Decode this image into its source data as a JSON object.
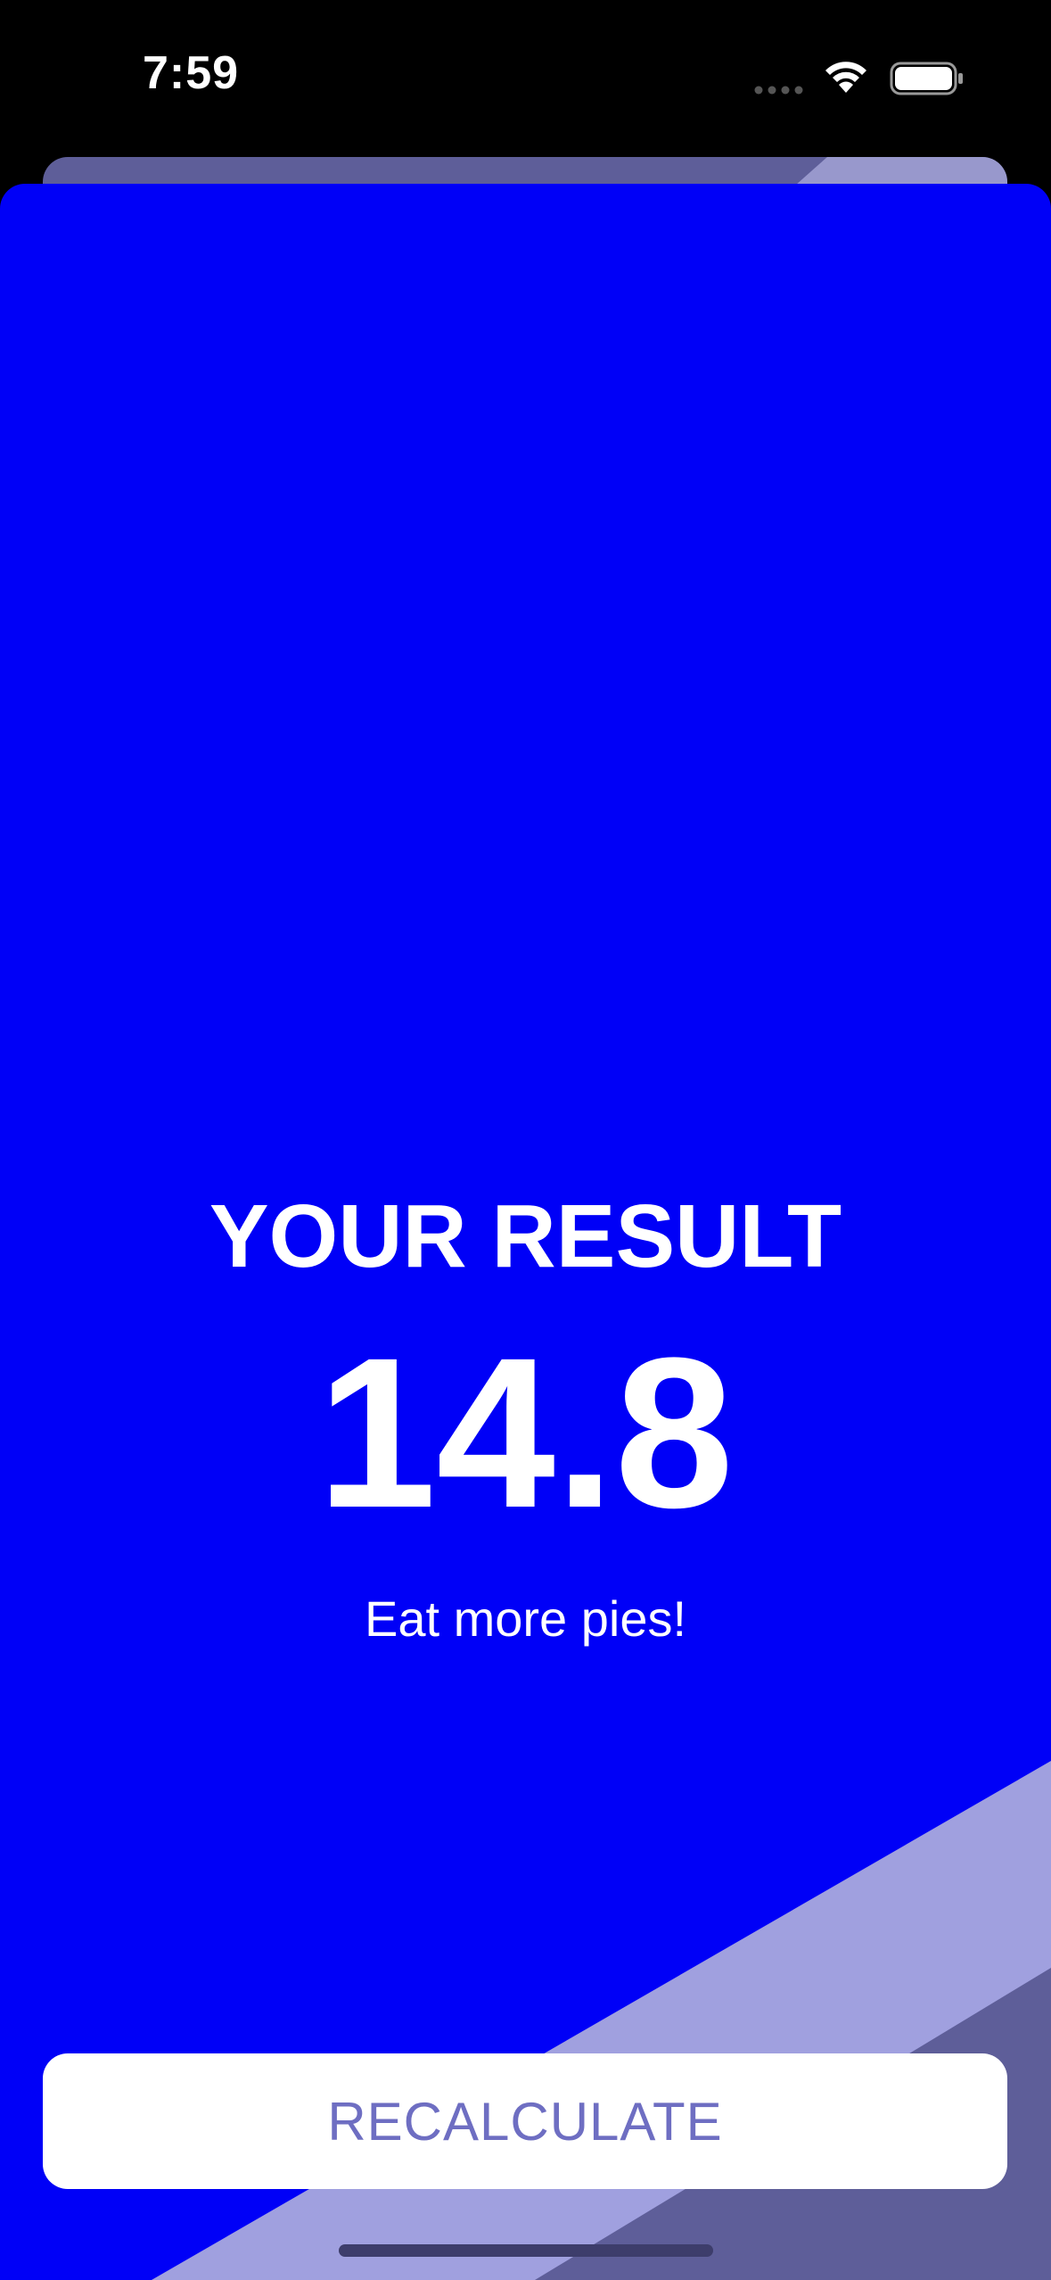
{
  "status_bar": {
    "time": "7:59",
    "icons": [
      "cellular-dots-icon",
      "wifi-icon",
      "battery-icon"
    ]
  },
  "result": {
    "title": "YOUR RESULT",
    "value": "14.8",
    "advice": "Eat more pies!"
  },
  "actions": {
    "recalculate_label": "RECALCULATE"
  },
  "colors": {
    "sheet_background": "#0000f7",
    "stripe_light": "#a0a0df",
    "stripe_dark": "#5e5e99",
    "button_background": "#ffffff",
    "button_text": "#6e6ec2",
    "text_primary": "#ffffff"
  }
}
